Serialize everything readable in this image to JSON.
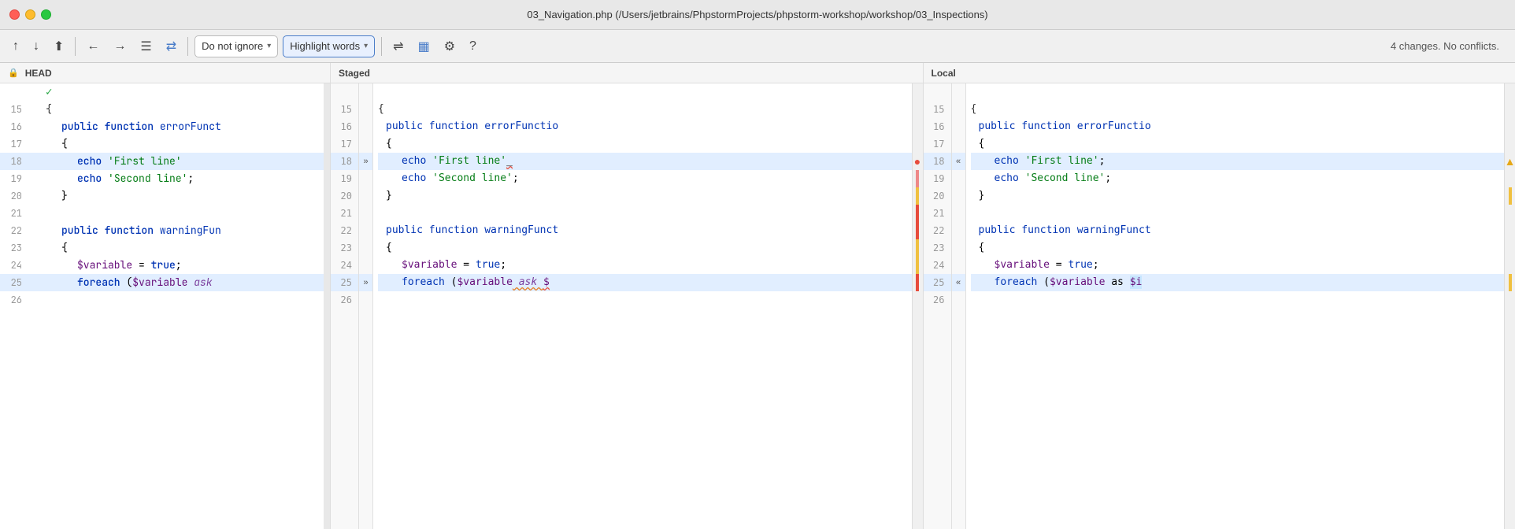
{
  "window": {
    "title": "03_Navigation.php (/Users/jetbrains/PhpstormProjects/phpstorm-workshop/workshop/03_Inspections)"
  },
  "toolbar": {
    "status": "4 changes. No conflicts.",
    "do_not_ignore_label": "Do not ignore",
    "highlight_words_label": "Highlight words",
    "chevron": "▾"
  },
  "panels": {
    "left_header": "HEAD",
    "center_header": "Staged",
    "right_header": "Local"
  },
  "lines": [
    {
      "num": 15,
      "content": "{",
      "type": "plain"
    },
    {
      "num": 16,
      "content": "    public function errorFunct",
      "type": "code"
    },
    {
      "num": 17,
      "content": "    {",
      "type": "plain"
    },
    {
      "num": 18,
      "content": "        echo 'First line'",
      "type": "highlighted",
      "arrow": "»"
    },
    {
      "num": 19,
      "content": "        echo 'Second line';",
      "type": "plain"
    },
    {
      "num": 20,
      "content": "    }",
      "type": "plain"
    },
    {
      "num": 21,
      "content": "",
      "type": "plain"
    },
    {
      "num": 22,
      "content": "    public function warningFun",
      "type": "code"
    },
    {
      "num": 23,
      "content": "    {",
      "type": "plain"
    },
    {
      "num": 24,
      "content": "        $variable = true;",
      "type": "plain"
    },
    {
      "num": 25,
      "content": "        foreach ($variable ask",
      "type": "highlighted",
      "arrow": "»"
    },
    {
      "num": 26,
      "content": "",
      "type": "plain"
    }
  ]
}
